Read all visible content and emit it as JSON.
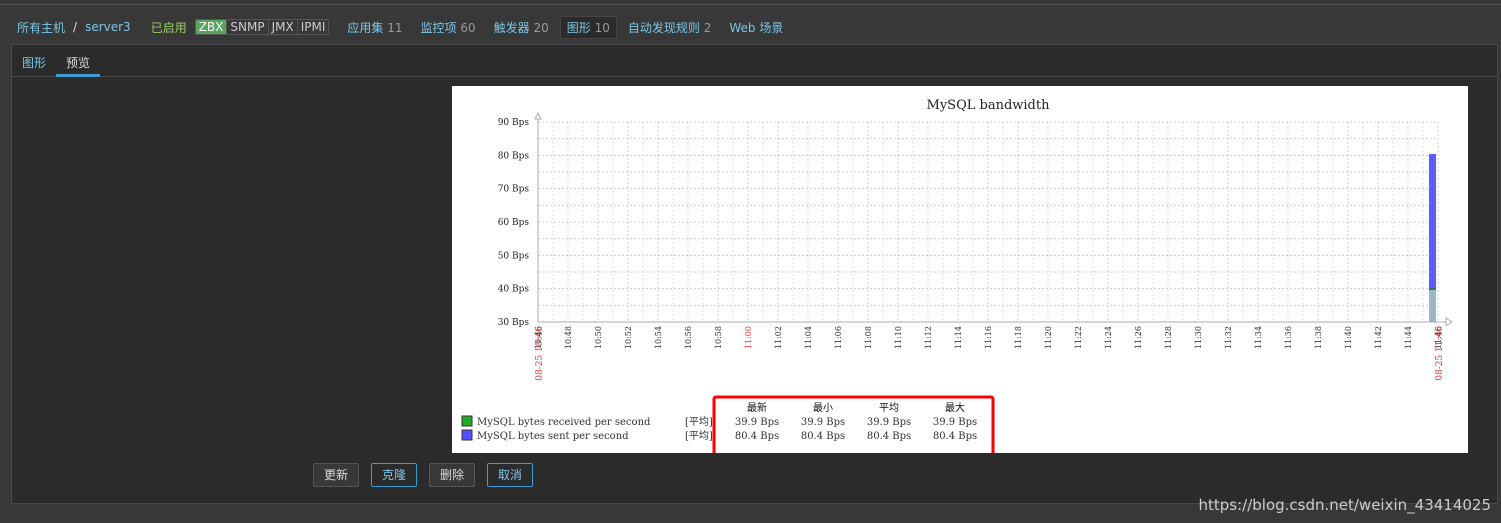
{
  "nav": {
    "all_hosts": "所有主机",
    "host": "server3",
    "status": "已启用",
    "badges": [
      "ZBX",
      "SNMP",
      "JMX",
      "IPMI"
    ],
    "links": [
      {
        "label": "应用集",
        "count": "11"
      },
      {
        "label": "监控项",
        "count": "60"
      },
      {
        "label": "触发器",
        "count": "20"
      },
      {
        "label": "图形",
        "count": "10",
        "active": true
      },
      {
        "label": "自动发现规则",
        "count": "2"
      },
      {
        "label": "Web 场景",
        "count": ""
      }
    ]
  },
  "tabs": [
    "图形",
    "预览"
  ],
  "buttons": {
    "update": "更新",
    "clone": "克隆",
    "delete": "删除",
    "cancel": "取消"
  },
  "watermark": "https://blog.csdn.net/weixin_43414025",
  "chart_data": {
    "type": "area",
    "title": "MySQL bandwidth",
    "ylim": [
      30,
      90
    ],
    "unit": "Bps",
    "yticks": [
      "30 Bps",
      "40 Bps",
      "50 Bps",
      "60 Bps",
      "70 Bps",
      "80 Bps",
      "90 Bps"
    ],
    "xticks": [
      "10:46",
      "10:48",
      "10:50",
      "10:52",
      "10:54",
      "10:56",
      "10:58",
      "11:00",
      "11:02",
      "11:04",
      "11:06",
      "11:08",
      "11:10",
      "11:12",
      "11:14",
      "11:16",
      "11:18",
      "11:20",
      "11:22",
      "11:24",
      "11:26",
      "11:28",
      "11:30",
      "11:32",
      "11:34",
      "11:36",
      "11:38",
      "11:40",
      "11:42",
      "11:44",
      "11:46"
    ],
    "xrange_labels": [
      "08-25 10:46",
      "08-25 11:46"
    ],
    "grid": true,
    "legend_headers": [
      "最新",
      "最小",
      "平均",
      "最大"
    ],
    "series": [
      {
        "name": "MySQL bytes received per second",
        "func": "[平均]",
        "color": "#22aa22",
        "last": "39.9 Bps",
        "min": "39.9 Bps",
        "avg": "39.9 Bps",
        "max": "39.9 Bps",
        "value": 39.9,
        "time": "11:46"
      },
      {
        "name": "MySQL bytes sent per second",
        "func": "[平均]",
        "color": "#5050ff",
        "last": "80.4 Bps",
        "min": "80.4 Bps",
        "avg": "80.4 Bps",
        "max": "80.4 Bps",
        "value": 80.4,
        "time": "11:46"
      }
    ]
  }
}
